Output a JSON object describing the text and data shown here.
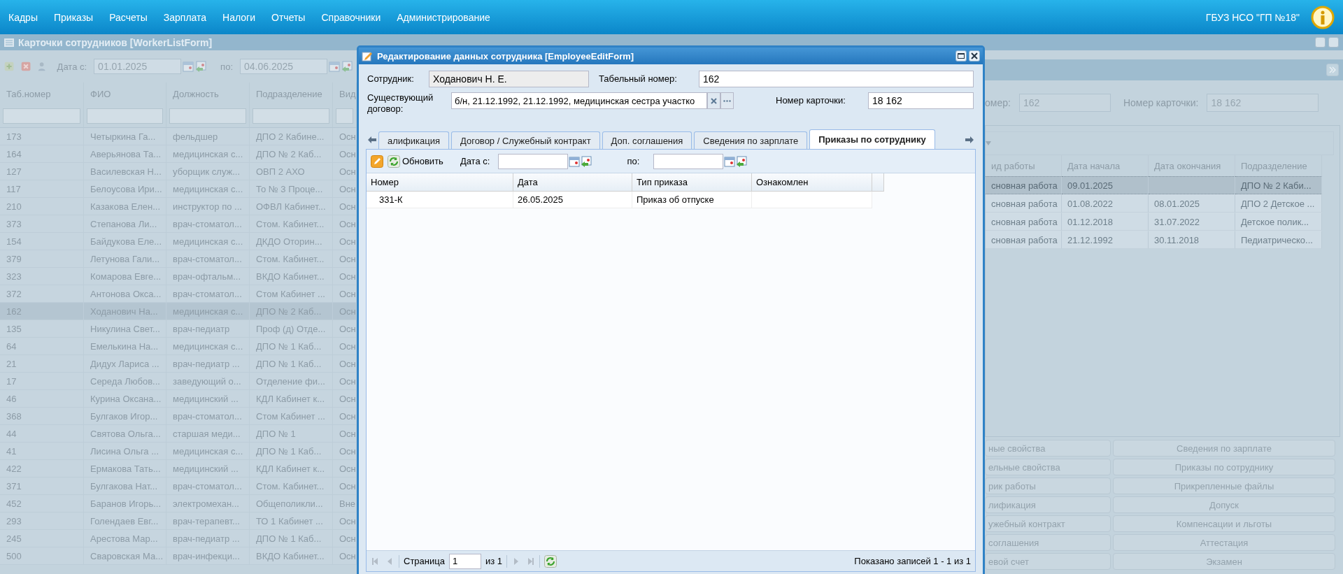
{
  "menu_bar": {
    "items": [
      "Кадры",
      "Приказы",
      "Расчеты",
      "Зарплата",
      "Налоги",
      "Отчеты",
      "Справочники",
      "Администрирование"
    ],
    "organization": "ГБУЗ НСО \"ГП №18\""
  },
  "list_window": {
    "title": "Карточки сотрудников [WorkerListForm]",
    "toolbar": {
      "date_from_label": "Дата с:",
      "date_from": "01.01.2025",
      "date_to_label": "по:",
      "date_to": "04.06.2025"
    },
    "table": {
      "columns": [
        "Таб.номер",
        "ФИО",
        "Должность",
        "Подразделение",
        "Вид"
      ],
      "rows": [
        {
          "cells": [
            "173",
            "Четыркина Га...",
            "фельдшер",
            "ДПО 2 Кабине...",
            "Осн"
          ],
          "selected": false
        },
        {
          "cells": [
            "164",
            "Аверьянова Та...",
            "медицинская с...",
            "ДПО № 2 Каб...",
            "Осн"
          ],
          "selected": false
        },
        {
          "cells": [
            "127",
            "Василевская Н...",
            "уборщик служ...",
            "ОВП 2 АХО",
            "Осн"
          ],
          "selected": false
        },
        {
          "cells": [
            "117",
            "Белоусова Ири...",
            "медицинская с...",
            "То № 3 Проце...",
            "Осн"
          ],
          "selected": false
        },
        {
          "cells": [
            "210",
            "Казакова Елен...",
            "инструктор по ...",
            "ОФВЛ Кабинет...",
            "Осн"
          ],
          "selected": false
        },
        {
          "cells": [
            "373",
            "Степанова Ли...",
            "врач-стоматол...",
            "Стом. Кабинет...",
            "Осн"
          ],
          "selected": false
        },
        {
          "cells": [
            "154",
            "Байдукова Еле...",
            "медицинская с...",
            "ДКДО Оторин...",
            "Осн"
          ],
          "selected": false
        },
        {
          "cells": [
            "379",
            "Летунова Гали...",
            "врач-стоматол...",
            "Стом. Кабинет...",
            "Осн"
          ],
          "selected": false
        },
        {
          "cells": [
            "323",
            "Комарова Евге...",
            "врач-офтальм...",
            "ВКДО Кабинет...",
            "Осн"
          ],
          "selected": false
        },
        {
          "cells": [
            "372",
            "Антонова Окса...",
            "врач-стоматол...",
            "Стом Кабинет ...",
            "Осн"
          ],
          "selected": false
        },
        {
          "cells": [
            "162",
            "Ходанович На...",
            "медицинская с...",
            "ДПО № 2 Каб...",
            "Осн"
          ],
          "selected": true
        },
        {
          "cells": [
            "135",
            "Никулина Свет...",
            "врач-педиатр",
            "Проф (д) Отде...",
            "Осн"
          ],
          "selected": false
        },
        {
          "cells": [
            "64",
            "Емелькина На...",
            "медицинская с...",
            "ДПО № 1 Каб...",
            "Осн"
          ],
          "selected": false
        },
        {
          "cells": [
            "21",
            "Дидух Лариса ...",
            "врач-педиатр ...",
            "ДПО № 1 Каб...",
            "Осн"
          ],
          "selected": false
        },
        {
          "cells": [
            "17",
            "Середа Любов...",
            "заведующий о...",
            "Отделение фи...",
            "Осн"
          ],
          "selected": false
        },
        {
          "cells": [
            "46",
            "Курина Оксана...",
            "медицинский ...",
            "КДЛ Кабинет к...",
            "Осн"
          ],
          "selected": false
        },
        {
          "cells": [
            "368",
            "Булгаков Игор...",
            "врач-стоматол...",
            "Стом Кабинет ...",
            "Осн"
          ],
          "selected": false
        },
        {
          "cells": [
            "44",
            "Святова Ольга...",
            "старшая меди...",
            "ДПО № 1",
            "Осн"
          ],
          "selected": false
        },
        {
          "cells": [
            "41",
            "Лисина Ольга ...",
            "медицинская с...",
            "ДПО № 1 Каб...",
            "Осн"
          ],
          "selected": false
        },
        {
          "cells": [
            "422",
            "Ермакова Тать...",
            "медицинский ...",
            "КДЛ Кабинет к...",
            "Осн"
          ],
          "selected": false
        },
        {
          "cells": [
            "371",
            "Булгакова Нат...",
            "врач-стоматол...",
            "Стом. Кабинет...",
            "Осн"
          ],
          "selected": false
        },
        {
          "cells": [
            "452",
            "Баранов Игорь...",
            "электромехан...",
            "Общеполикли...",
            "Вне"
          ],
          "selected": false
        },
        {
          "cells": [
            "293",
            "Голендаев Евг...",
            "врач-терапевт...",
            "ТО 1 Кабинет ...",
            "Осн"
          ],
          "selected": false
        },
        {
          "cells": [
            "245",
            "Арестова Мар...",
            "врач-педиатр ...",
            "ДПО № 1 Каб...",
            "Осн"
          ],
          "selected": false
        },
        {
          "cells": [
            "500",
            "Сваровская Ма...",
            "врач-инфекци...",
            "ВКДО Кабинет...",
            "Осн"
          ],
          "selected": false
        }
      ]
    }
  },
  "detail_panel": {
    "tab_number_label": "омер:",
    "tab_number": "162",
    "card_number_label": "Номер карточки:",
    "card_number": "18 162",
    "table": {
      "columns": [
        "ид работы",
        "Дата начала",
        "Дата окончания",
        "Подразделение"
      ],
      "rows": [
        {
          "cells": [
            "сновная работа",
            "09.01.2025",
            "",
            "ДПО № 2 Каби..."
          ],
          "selected": true
        },
        {
          "cells": [
            "сновная работа",
            "01.08.2022",
            "08.01.2025",
            "ДПО 2 Детское ..."
          ],
          "selected": false
        },
        {
          "cells": [
            "сновная работа",
            "01.12.2018",
            "31.07.2022",
            "Детское полик..."
          ],
          "selected": false
        },
        {
          "cells": [
            "сновная работа",
            "21.12.1992",
            "30.11.2018",
            "Педиатрическо..."
          ],
          "selected": false
        }
      ]
    },
    "buttons_left": [
      "ные свойства",
      "ельные свойства",
      "рик работы",
      "лификация",
      "ужебный контракт",
      "соглашения",
      "евой счет"
    ],
    "buttons_right": [
      "Сведения по зарплате",
      "Приказы по сотруднику",
      "Прикрепленные файлы",
      "Допуск",
      "Компенсации и льготы",
      "Аттестация",
      "Экзамен"
    ]
  },
  "edit_dialog": {
    "title": "Редактирование данных сотрудника [EmployeeEditForm]",
    "employee_label": "Сотрудник:",
    "employee": "Ходанович Н. Е.",
    "tab_number_label": "Табельный номер:",
    "tab_number": "162",
    "contract_label": "Существующий договор:",
    "contract": "б/н, 21.12.1992, 21.12.1992, медицинская сестра участко",
    "card_number_label": "Номер карточки:",
    "card_number": "18 162",
    "tabs": [
      {
        "label": "алификация",
        "selected": false
      },
      {
        "label": "Договор / Служебный контракт",
        "selected": false
      },
      {
        "label": "Доп. соглашения",
        "selected": false
      },
      {
        "label": "Сведения по зарплате",
        "selected": false
      },
      {
        "label": "Приказы по сотруднику",
        "selected": true
      }
    ],
    "toolbar": {
      "refresh": "Обновить",
      "date_from_label": "Дата с:",
      "date_to_label": "по:"
    },
    "table": {
      "columns": [
        "Номер",
        "Дата",
        "Тип приказа",
        "Ознакомлен"
      ],
      "rows": [
        {
          "cells": [
            "331-К",
            "26.05.2025",
            "Приказ об отпуске",
            ""
          ]
        }
      ]
    },
    "pager": {
      "page_label": "Страница",
      "page": "1",
      "of": "из 1",
      "summary": "Показано записей 1 - 1 из 1"
    }
  }
}
